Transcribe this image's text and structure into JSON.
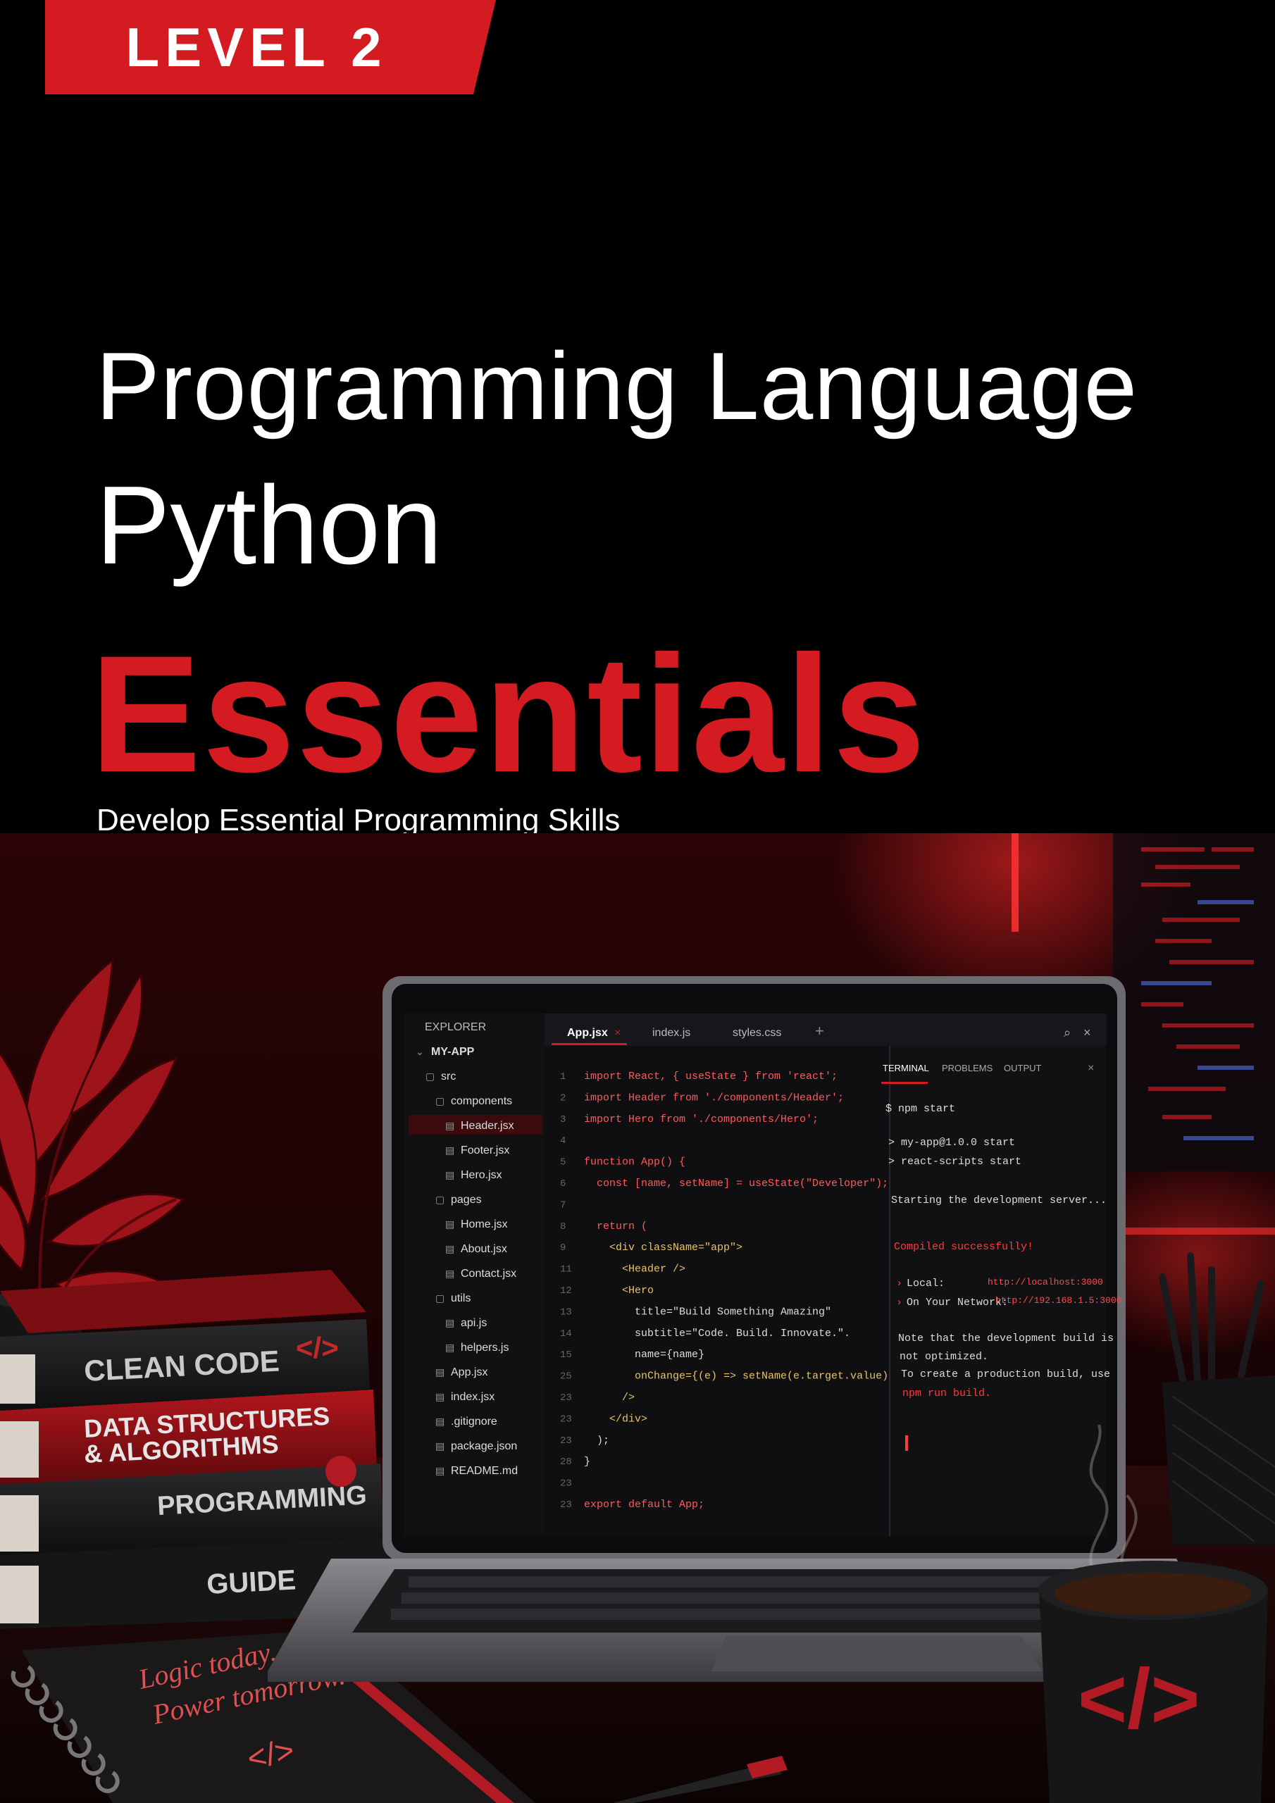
{
  "cover": {
    "badge": "LEVEL 2",
    "title_line1": "Programming Language",
    "title_line2": "Python",
    "title_line3": "Essentials",
    "subtitle": "Develop Essential Programming Skills"
  },
  "editor": {
    "explorer_title": "EXPLORER",
    "tabs": [
      "App.jsx",
      "index.js",
      "styles.css"
    ],
    "tree": [
      {
        "label": "MY-APP",
        "indent": 0,
        "kind": "root"
      },
      {
        "label": "src",
        "indent": 1,
        "kind": "folder"
      },
      {
        "label": "components",
        "indent": 2,
        "kind": "folder"
      },
      {
        "label": "Header.jsx",
        "indent": 3,
        "kind": "file",
        "selected": true
      },
      {
        "label": "Footer.jsx",
        "indent": 3,
        "kind": "file"
      },
      {
        "label": "Hero.jsx",
        "indent": 3,
        "kind": "file"
      },
      {
        "label": "pages",
        "indent": 2,
        "kind": "folder"
      },
      {
        "label": "Home.jsx",
        "indent": 3,
        "kind": "file"
      },
      {
        "label": "About.jsx",
        "indent": 3,
        "kind": "file"
      },
      {
        "label": "Contact.jsx",
        "indent": 3,
        "kind": "file"
      },
      {
        "label": "utils",
        "indent": 2,
        "kind": "folder"
      },
      {
        "label": "api.js",
        "indent": 3,
        "kind": "file"
      },
      {
        "label": "helpers.js",
        "indent": 3,
        "kind": "file"
      },
      {
        "label": "App.jsx",
        "indent": 2,
        "kind": "file"
      },
      {
        "label": "index.jsx",
        "indent": 2,
        "kind": "file"
      },
      {
        "label": ".gitignore",
        "indent": 2,
        "kind": "file"
      },
      {
        "label": "package.json",
        "indent": 2,
        "kind": "file"
      },
      {
        "label": "README.md",
        "indent": 2,
        "kind": "file"
      }
    ],
    "code": [
      {
        "n": "1",
        "text": "import React, { useState } from 'react';"
      },
      {
        "n": "2",
        "text": "import Header from './components/Header';"
      },
      {
        "n": "3",
        "text": "import Hero from './components/Hero';"
      },
      {
        "n": "4",
        "text": ""
      },
      {
        "n": "5",
        "text": "function App() {"
      },
      {
        "n": "6",
        "text": "  const [name, setName] = useState(\"Developer\");"
      },
      {
        "n": "7",
        "text": ""
      },
      {
        "n": "8",
        "text": "  return ("
      },
      {
        "n": "9",
        "text": "    <div className=\"app\">"
      },
      {
        "n": "11",
        "text": "      <Header />"
      },
      {
        "n": "12",
        "text": "      <Hero"
      },
      {
        "n": "13",
        "text": "        title=\"Build Something Amazing\""
      },
      {
        "n": "14",
        "text": "        subtitle=\"Code. Build. Innovate.\"."
      },
      {
        "n": "15",
        "text": "        name={name}"
      },
      {
        "n": "25",
        "text": "        onChange={(e) => setName(e.target.value)}"
      },
      {
        "n": "23",
        "text": "      />"
      },
      {
        "n": "23",
        "text": "    </div>"
      },
      {
        "n": "23",
        "text": "  );"
      },
      {
        "n": "28",
        "text": "}"
      },
      {
        "n": "23",
        "text": ""
      },
      {
        "n": "23",
        "text": "export default App;"
      }
    ],
    "terminal_tabs": [
      "TERMINAL",
      "PROBLEMS",
      "OUTPUT"
    ],
    "terminal": {
      "cmd": "$ npm start",
      "lines": [
        "> my-app@1.0.0 start",
        "> react-scripts start"
      ],
      "starting": "Starting the development server...",
      "success": "Compiled successfully!",
      "local_label": "Local:",
      "local_url": "http://localhost:3000",
      "network_label": "On Your Network:",
      "network_url": "http://192.168.1.5:3000",
      "note1": "Note that the development build is",
      "note2": "not optimized.",
      "note3": "To create a production build, use",
      "note4": "npm run build."
    }
  },
  "books": {
    "book1": "CLEAN CODE",
    "book2a": "DATA STRUCTURES",
    "book2b": "& ALGORITHMS",
    "book3": "PROGRAMMING",
    "book4": "GUIDE",
    "code_symbol": "</>"
  },
  "notebook": {
    "line1": "Logic today,",
    "line2": "Power tomorrow.",
    "symbol": "</>"
  },
  "mug": {
    "symbol": "</>"
  },
  "colors": {
    "accent": "#d41b22",
    "background": "#000000"
  }
}
